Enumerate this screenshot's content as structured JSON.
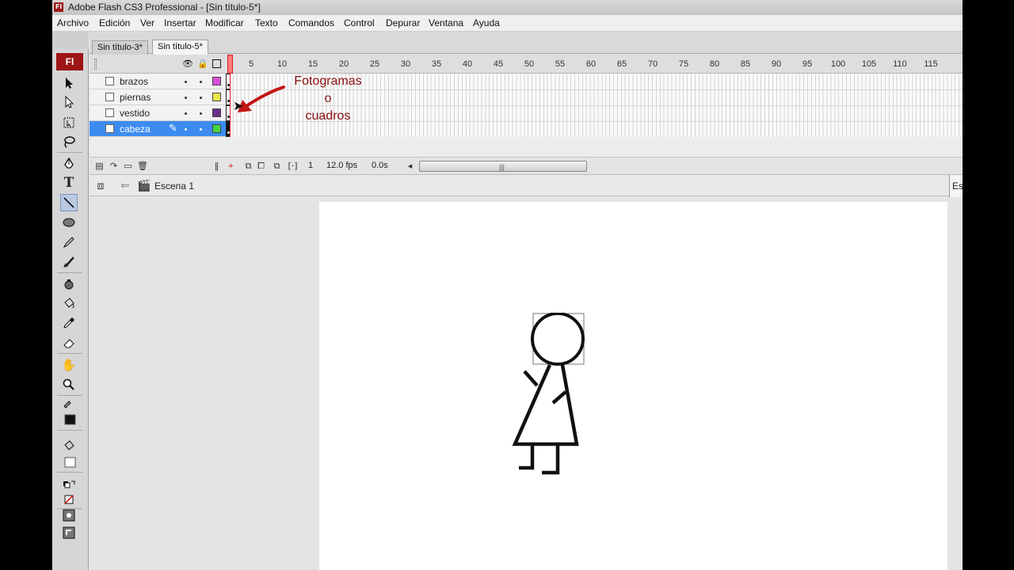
{
  "window": {
    "title": "Adobe Flash CS3 Professional - [Sin título-5*]",
    "logo": "Fl"
  },
  "menu": [
    "Archivo",
    "Edición",
    "Ver",
    "Insertar",
    "Modificar",
    "Texto",
    "Comandos",
    "Control",
    "Depurar",
    "Ventana",
    "Ayuda"
  ],
  "tools": {
    "badge": "Fl",
    "items": [
      "selection-tool",
      "subselection-tool",
      "free-transform-tool",
      "lasso-tool",
      "pen-tool",
      "text-tool",
      "line-tool",
      "oval-tool",
      "pencil-tool",
      "brush-tool",
      "ink-bottle-tool",
      "paint-bucket-tool",
      "eyedropper-tool",
      "eraser-tool",
      "hand-tool",
      "zoom-tool",
      "stroke-color",
      "fill-color",
      "swap-colors",
      "no-color",
      "snap-option",
      "smooth-option"
    ],
    "active": "line-tool"
  },
  "tabs": [
    {
      "label": "Sin título-3*",
      "active": false
    },
    {
      "label": "Sin título-5*",
      "active": true
    }
  ],
  "timeline": {
    "ruler": [
      "5",
      "10",
      "15",
      "20",
      "25",
      "30",
      "35",
      "40",
      "45",
      "50",
      "55",
      "60",
      "65",
      "70",
      "75",
      "80",
      "85",
      "90",
      "95",
      "100",
      "105",
      "110",
      "115"
    ],
    "layers": [
      {
        "name": "brazos",
        "color": "#d94fd9",
        "selected": false
      },
      {
        "name": "piernas",
        "color": "#e8e84a",
        "selected": false
      },
      {
        "name": "vestido",
        "color": "#6a2f8a",
        "selected": false
      },
      {
        "name": "cabeza",
        "color": "#44d444",
        "selected": true
      }
    ],
    "current_frame": "1",
    "fps": "12.0 fps",
    "time": "0.0s"
  },
  "editbar": {
    "scene": "Escena 1",
    "right_text": "Esp"
  },
  "annotation": {
    "line1": "Fotogramas",
    "line2": "o",
    "line3": "cuadros",
    "color": "#8b0f0f"
  }
}
